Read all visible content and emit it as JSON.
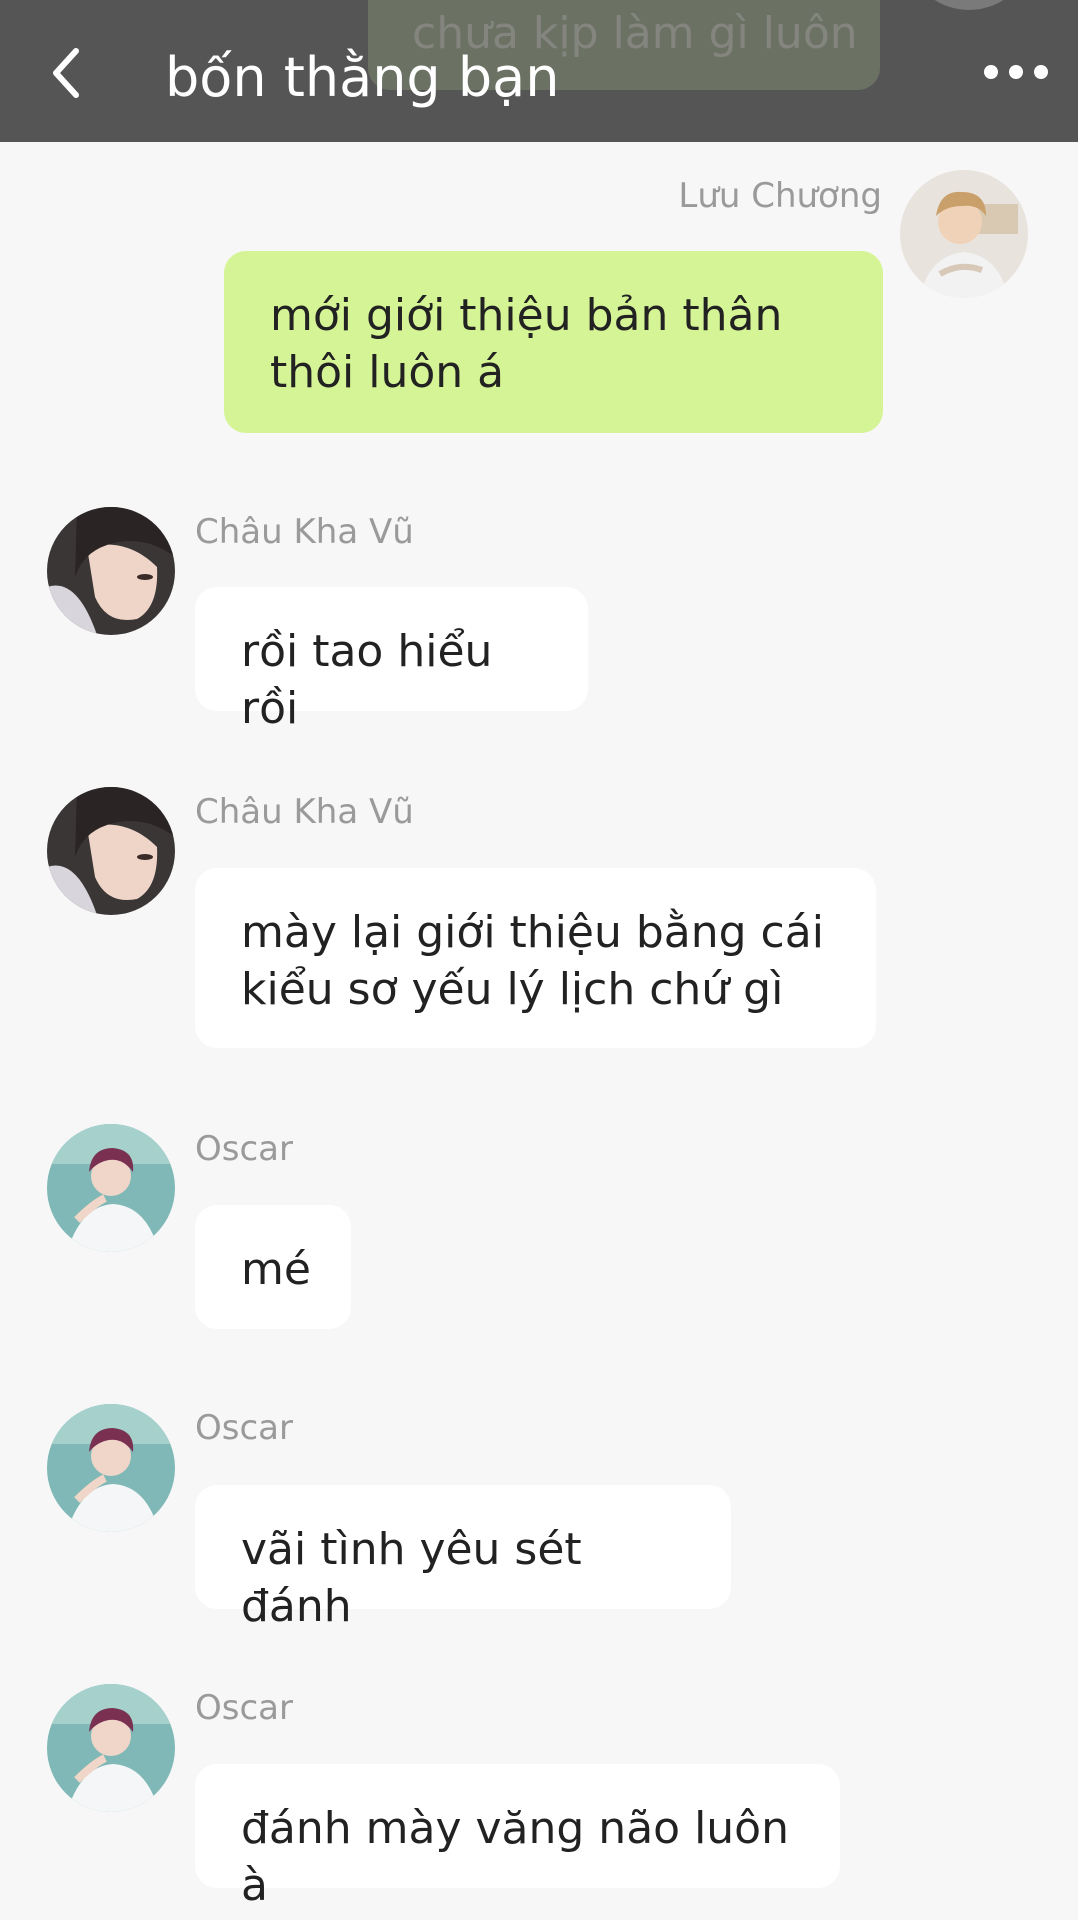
{
  "header": {
    "title": "bốn thằng bạn",
    "peek_message": "chưa kịp làm gì luôn"
  },
  "messages": [
    {
      "sender": "Lưu Chương",
      "text": "mới giới thiệu bản thân thôi luôn á",
      "side": "right"
    },
    {
      "sender": "Châu Kha Vũ",
      "text": "rồi tao hiểu rồi",
      "side": "left"
    },
    {
      "sender": "Châu Kha Vũ",
      "text": "mày lại giới thiệu bằng cái kiểu sơ yếu lý lịch chứ gì",
      "side": "left"
    },
    {
      "sender": "Oscar",
      "text": "mé",
      "side": "left"
    },
    {
      "sender": "Oscar",
      "text": "vãi tình yêu sét đánh",
      "side": "left"
    },
    {
      "sender": "Oscar",
      "text": "đánh mày văng não luôn à",
      "side": "left"
    }
  ],
  "colors": {
    "header_bg": "#555555",
    "own_bubble": "#d5f495",
    "other_bubble": "#ffffff",
    "background": "#f7f7f7"
  }
}
